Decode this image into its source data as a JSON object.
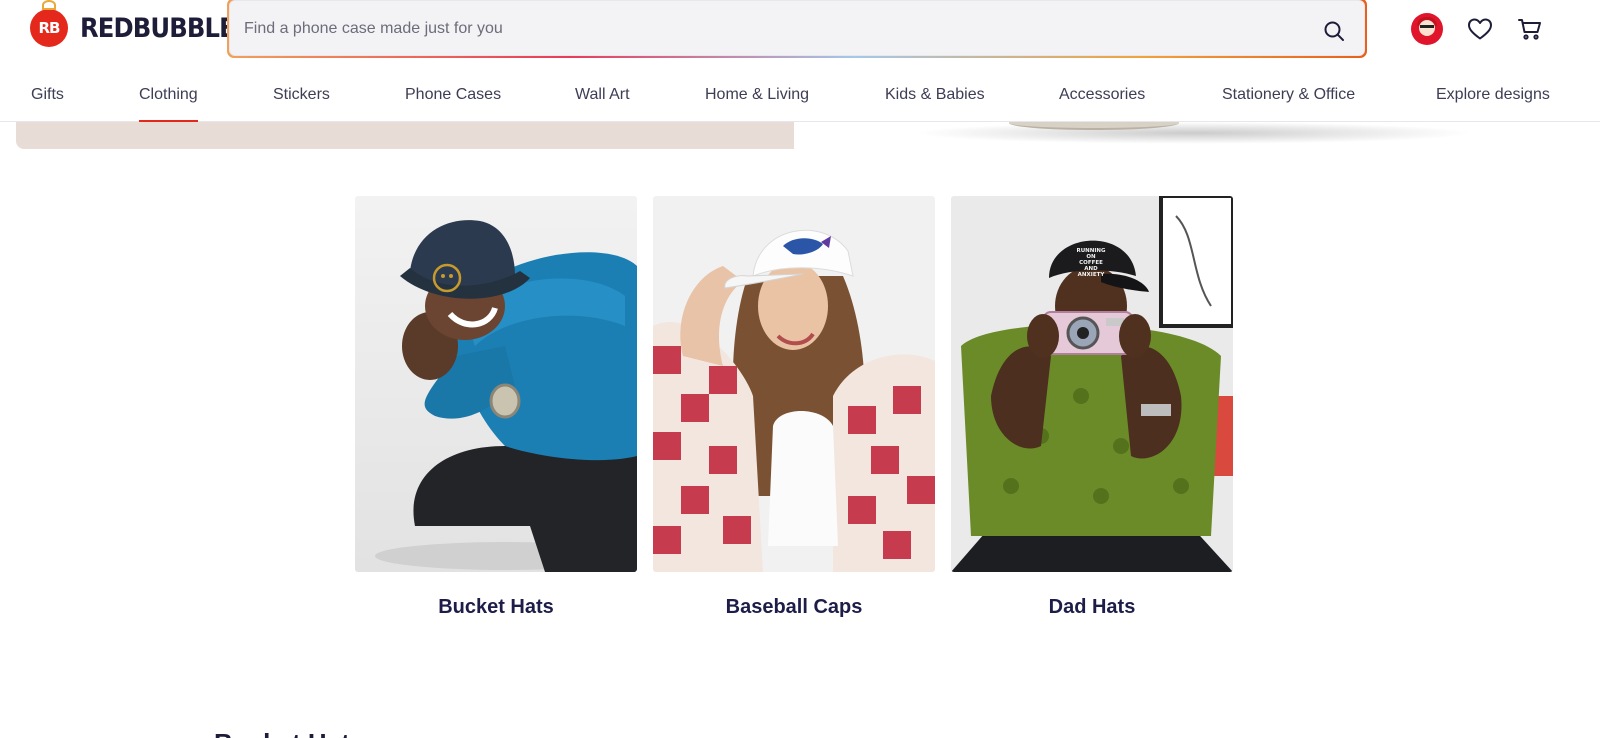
{
  "header": {
    "logo_text": "REDBUBBLE",
    "logo_mark": "RB",
    "search_placeholder": "Find a phone case made just for you",
    "icons": [
      "search-icon",
      "avatar",
      "heart-icon",
      "cart-icon"
    ]
  },
  "nav": {
    "items": [
      {
        "label": "Gifts"
      },
      {
        "label": "Clothing",
        "active": true
      },
      {
        "label": "Stickers"
      },
      {
        "label": "Phone Cases"
      },
      {
        "label": "Wall Art"
      },
      {
        "label": "Home & Living"
      },
      {
        "label": "Kids & Babies"
      },
      {
        "label": "Accessories"
      },
      {
        "label": "Stationery & Office"
      },
      {
        "label": "Explore designs"
      }
    ]
  },
  "categories": [
    {
      "title": "Bucket Hats"
    },
    {
      "title": "Baseball Caps"
    },
    {
      "title": "Dad Hats",
      "hat_print": "RUNNING ON COFFEE AND ANXIETY"
    }
  ],
  "section": {
    "heading": "Bucket Hats"
  },
  "colors": {
    "brand_red": "#e4281c",
    "text_navy": "#1d1d48",
    "hero_beige": "#e7ddd6"
  }
}
